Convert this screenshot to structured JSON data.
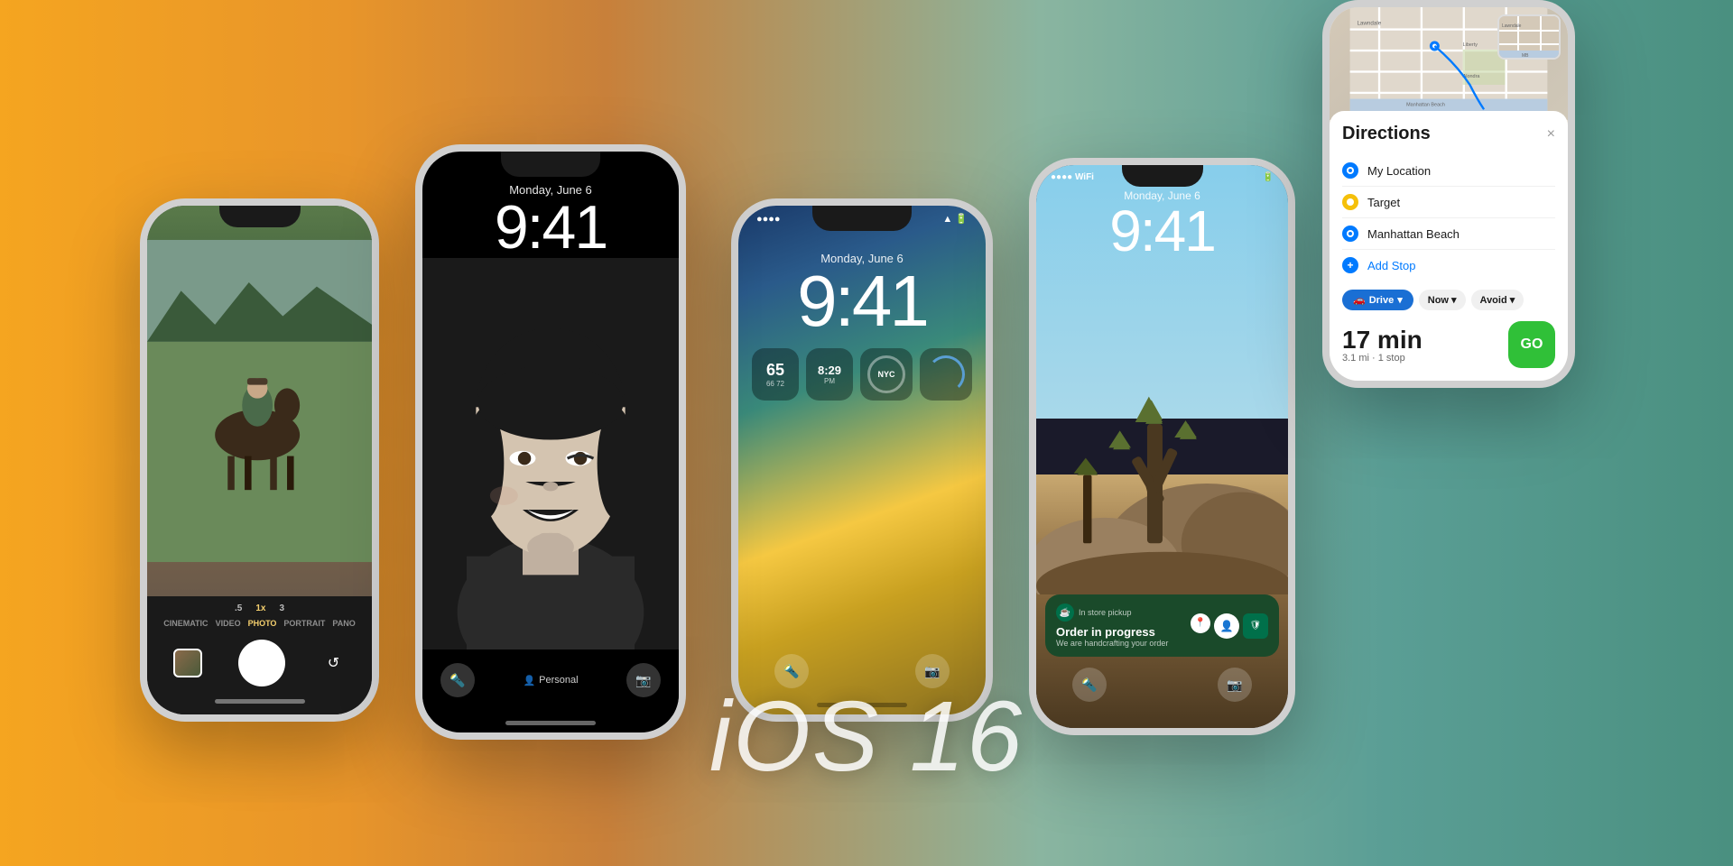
{
  "page": {
    "title": "iOS 16",
    "background": "gradient orange to teal"
  },
  "ios_title": {
    "text": "iOS 16"
  },
  "phone_camera": {
    "mode_tabs": [
      "CINEMATIC",
      "VIDEO",
      "PHOTO",
      "PORTRAIT",
      "PANO"
    ],
    "active_mode": "PHOTO",
    "zoom_levels": [
      ".5",
      "1x",
      "3"
    ],
    "active_zoom": "1x"
  },
  "phone_portrait": {
    "date": "Monday, June 6",
    "time": "9:41",
    "focus_label": "Personal",
    "torch_icon": "🔦",
    "camera_icon": "📷"
  },
  "phone_color": {
    "date": "Monday, June 6",
    "time": "9:41",
    "widgets": [
      {
        "type": "weather",
        "value": "65",
        "sub": "66  72"
      },
      {
        "type": "time",
        "value": "8:29",
        "sub": "PM"
      },
      {
        "type": "nyc",
        "label": "NYC"
      },
      {
        "type": "ring"
      }
    ]
  },
  "phone_joshua": {
    "date": "Monday, June 6",
    "time": "9:41",
    "notification": {
      "app": "Starbucks",
      "header": "In store pickup",
      "title": "Order in progress",
      "body": "We are handcrafting your order"
    }
  },
  "phone_maps": {
    "title": "Directions",
    "close_label": "×",
    "directions": [
      {
        "type": "my_location",
        "label": "My Location",
        "dot_color": "blue"
      },
      {
        "type": "target",
        "label": "Target",
        "dot_color": "yellow"
      },
      {
        "type": "destination",
        "label": "Manhattan Beach",
        "dot_color": "blue"
      }
    ],
    "add_stop_label": "Add Stop",
    "transport_options": [
      "Drive",
      "Now",
      "Avoid"
    ],
    "drive_label": "Drive",
    "now_label": "Now",
    "avoid_label": "Avoid",
    "route": {
      "time": "17 min",
      "distance": "3.1 mi · 1 stop"
    },
    "go_button": "GO",
    "map_labels": [
      "Lawndale",
      "Liberty Village",
      "Alondra Park",
      "Manhattan Beach"
    ]
  }
}
